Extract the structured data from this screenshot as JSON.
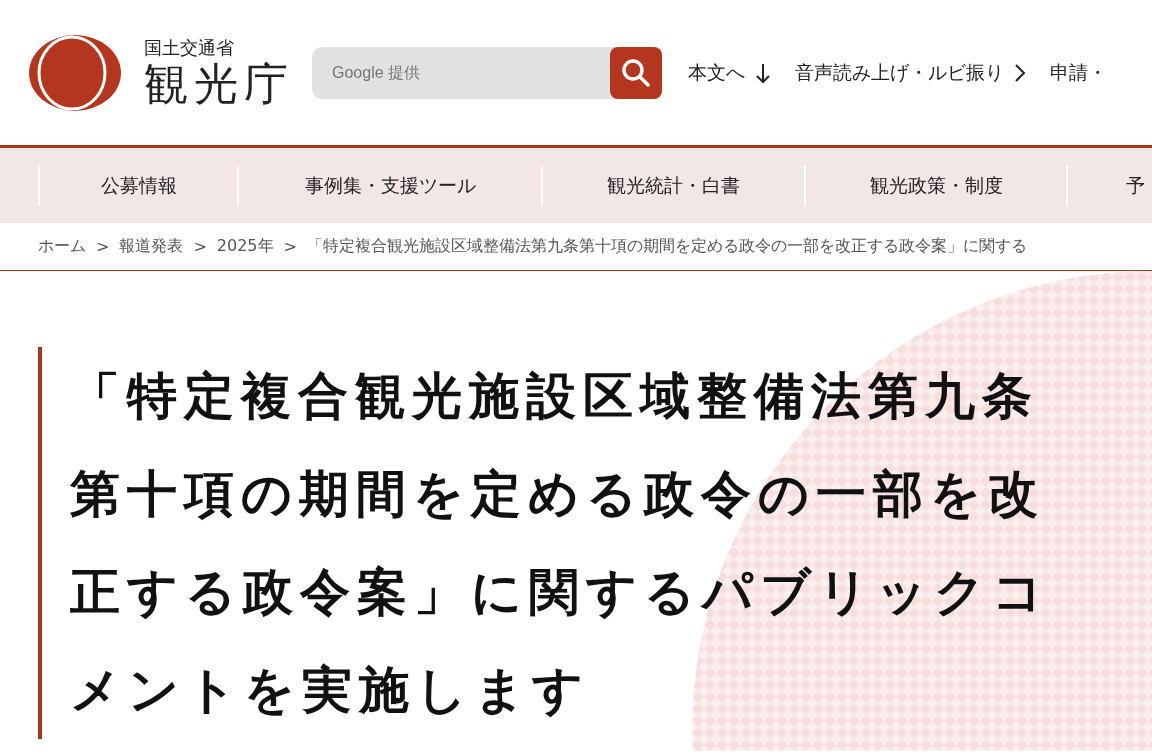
{
  "header": {
    "logo": {
      "ministry": "国土交通省",
      "agency": "観光庁"
    },
    "search": {
      "placeholder": "Google 提供"
    },
    "links": [
      {
        "label": "本文へ",
        "kind": "down"
      },
      {
        "label": "音声読み上げ・ルビ振り",
        "kind": "next"
      },
      {
        "label": "申請・",
        "kind": "plain"
      }
    ]
  },
  "nav": {
    "items": [
      "公募情報",
      "事例集・支援ツール",
      "観光統計・白書",
      "観光政策・制度",
      "予"
    ]
  },
  "breadcrumb": [
    {
      "label": "ホーム"
    },
    {
      "separator": ">",
      "label": "報道発表"
    },
    {
      "separator": ">",
      "label": "2025年"
    },
    {
      "separator": ">",
      "label": "「特定複合観光施設区域整備法第九条第十項の期間を定める政令の一部を改正する政令案」に関する"
    }
  ],
  "title": "「特定複合観光施設区域整備法第九条第十項の期間を定める政令の一部を改正する政令案」に関するパブリックコメントを実施します"
}
